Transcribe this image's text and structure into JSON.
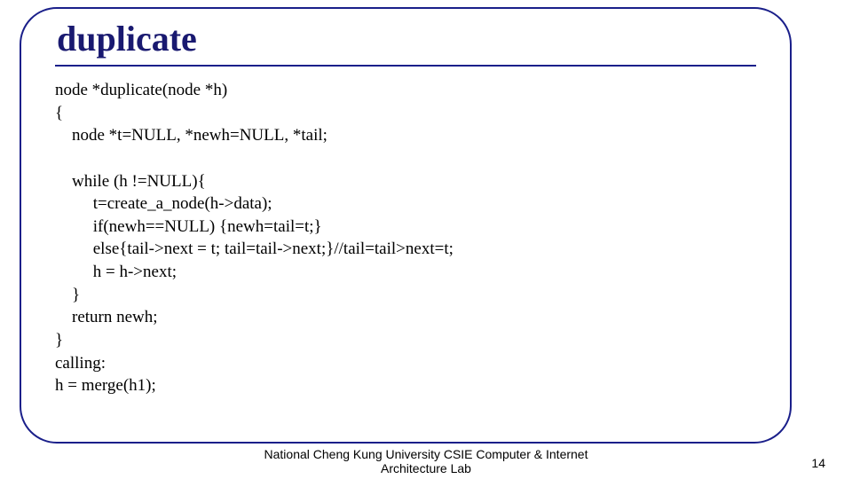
{
  "slide": {
    "title": "duplicate",
    "code": "node *duplicate(node *h)\n{\n    node *t=NULL, *newh=NULL, *tail;\n\n    while (h !=NULL){\n         t=create_a_node(h->data);\n         if(newh==NULL) {newh=tail=t;}\n         else{tail->next = t; tail=tail->next;}//tail=tail>next=t;\n         h = h->next;\n    }\n    return newh;\n}\ncalling:\nh = merge(h1);",
    "footer": "National Cheng Kung University CSIE Computer & Internet Architecture Lab",
    "page": "14"
  }
}
